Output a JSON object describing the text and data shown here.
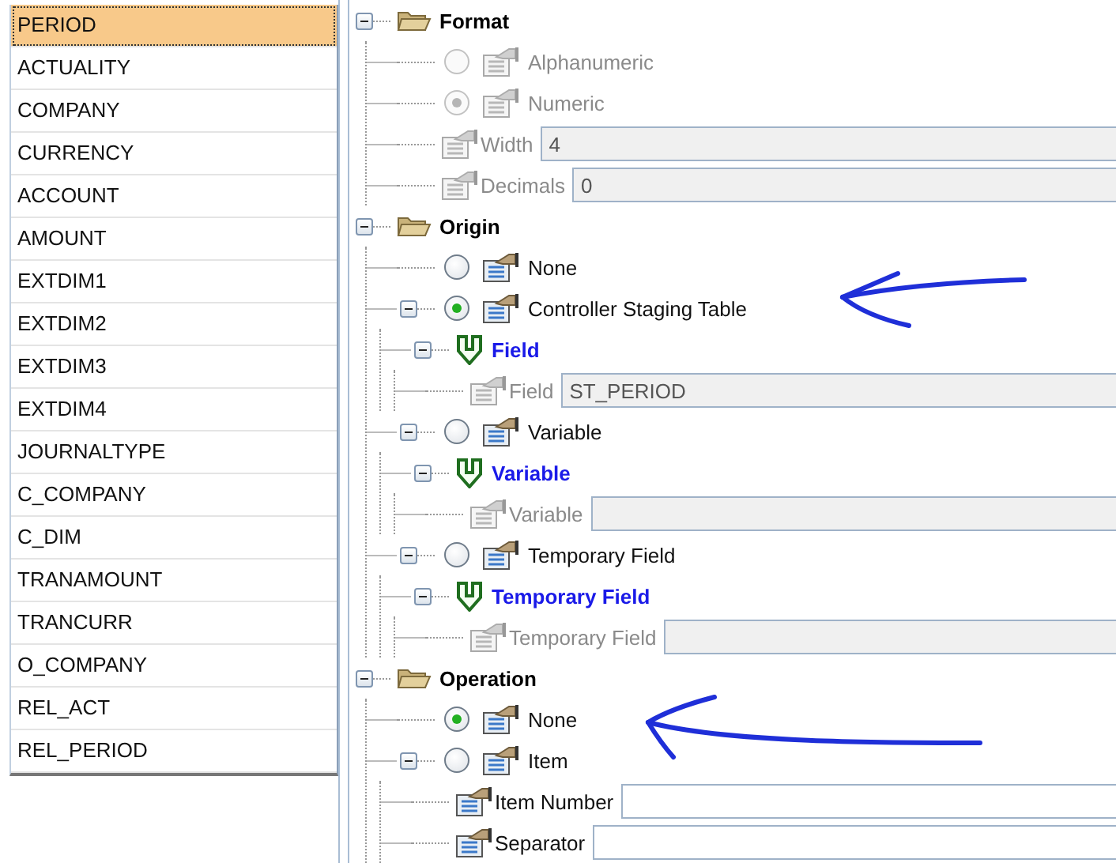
{
  "field_list": {
    "items": [
      {
        "label": "PERIOD",
        "selected": true
      },
      {
        "label": "ACTUALITY",
        "selected": false
      },
      {
        "label": "COMPANY",
        "selected": false
      },
      {
        "label": "CURRENCY",
        "selected": false
      },
      {
        "label": "ACCOUNT",
        "selected": false
      },
      {
        "label": "AMOUNT",
        "selected": false
      },
      {
        "label": "EXTDIM1",
        "selected": false
      },
      {
        "label": "EXTDIM2",
        "selected": false
      },
      {
        "label": "EXTDIM3",
        "selected": false
      },
      {
        "label": "EXTDIM4",
        "selected": false
      },
      {
        "label": "JOURNALTYPE",
        "selected": false
      },
      {
        "label": "C_COMPANY",
        "selected": false
      },
      {
        "label": "C_DIM",
        "selected": false
      },
      {
        "label": "TRANAMOUNT",
        "selected": false
      },
      {
        "label": "TRANCURR",
        "selected": false
      },
      {
        "label": "O_COMPANY",
        "selected": false
      },
      {
        "label": "REL_ACT",
        "selected": false
      },
      {
        "label": "REL_PERIOD",
        "selected": false
      }
    ]
  },
  "tree": [
    {
      "kind": "group",
      "label": "Format",
      "expanded": true,
      "children": [
        {
          "kind": "radio",
          "label": "Alphanumeric",
          "selected": false,
          "disabled": true
        },
        {
          "kind": "radio",
          "label": "Numeric",
          "selected": true,
          "disabled": true
        },
        {
          "kind": "field",
          "label": "Width",
          "value": "4",
          "disabled": true
        },
        {
          "kind": "field",
          "label": "Decimals",
          "value": "0",
          "disabled": true
        }
      ]
    },
    {
      "kind": "group",
      "label": "Origin",
      "expanded": true,
      "children": [
        {
          "kind": "radio",
          "label": "None",
          "selected": false,
          "disabled": false
        },
        {
          "kind": "radio",
          "label": "Controller Staging Table",
          "selected": true,
          "disabled": false,
          "expanded": true,
          "children": [
            {
              "kind": "branch",
              "label": "Field",
              "expanded": true,
              "children": [
                {
                  "kind": "field",
                  "label": "Field",
                  "value": "ST_PERIOD",
                  "disabled": true
                }
              ]
            }
          ]
        },
        {
          "kind": "radio",
          "label": "Variable",
          "selected": false,
          "disabled": false,
          "expanded": true,
          "children": [
            {
              "kind": "branch",
              "label": "Variable",
              "expanded": true,
              "children": [
                {
                  "kind": "field",
                  "label": "Variable",
                  "disabled": true
                }
              ]
            }
          ]
        },
        {
          "kind": "radio",
          "label": "Temporary Field",
          "selected": false,
          "disabled": false,
          "expanded": true,
          "children": [
            {
              "kind": "branch",
              "label": "Temporary Field",
              "expanded": true,
              "children": [
                {
                  "kind": "field",
                  "label": "Temporary Field",
                  "disabled": true
                }
              ]
            }
          ]
        }
      ]
    },
    {
      "kind": "group",
      "label": "Operation",
      "expanded": true,
      "children": [
        {
          "kind": "radio",
          "label": "None",
          "selected": true,
          "disabled": false
        },
        {
          "kind": "radio",
          "label": "Item",
          "selected": false,
          "disabled": false,
          "expanded": true,
          "children": [
            {
              "kind": "field",
              "label": "Item Number",
              "disabled": false
            },
            {
              "kind": "field",
              "label": "Separator",
              "disabled": false
            }
          ]
        }
      ]
    }
  ]
}
